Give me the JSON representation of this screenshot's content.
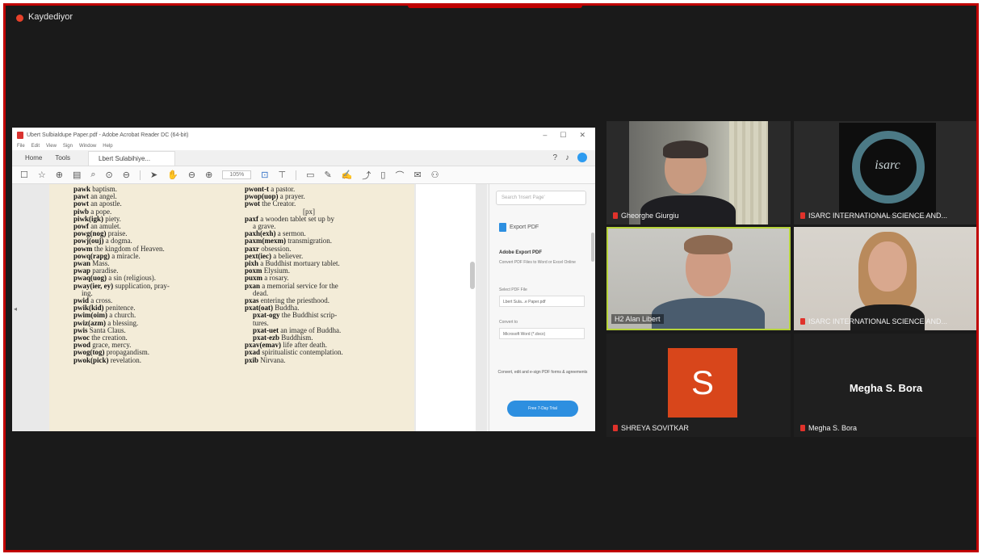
{
  "recording": {
    "label": "Kaydediyor"
  },
  "acrobat": {
    "window_title": "Ubert Sulbialdupe Paper.pdf - Adobe Acrobat Reader DC (64-bit)",
    "window_controls": [
      "–",
      "☐",
      "✕"
    ],
    "menu": [
      "File",
      "Edit",
      "View",
      "Sign",
      "Window",
      "Help"
    ],
    "tabs": {
      "home": "Home",
      "tools": "Tools",
      "doc": "Lbert Sulabihiye..."
    },
    "zoom": "105%",
    "search_placeholder": "Search 'Insert Page'",
    "export": {
      "header": "Export PDF",
      "title": "Adobe Export PDF",
      "description": "Convert PDF Files to Word or Excel Online",
      "select_label": "Select PDF File",
      "selected_file": "Lbert Sula...e Paper.pdf",
      "convert_label": "Convert to",
      "convert_value": "Microsoft Word (*.docx)",
      "promo": "Convert, edit and e-sign PDF forms & agreements",
      "cta": "Free 7-Day Trial"
    },
    "dictionary": {
      "left": [
        {
          "hw": "pawk",
          "def": "baptism."
        },
        {
          "hw": "pawt",
          "def": "an angel."
        },
        {
          "hw": "powt",
          "def": "an apostle."
        },
        {
          "hw": "piwb",
          "def": "a pope."
        },
        {
          "hw": "piwk(igk)",
          "def": "piety."
        },
        {
          "hw": "powf",
          "def": "an amulet."
        },
        {
          "hw": "powg(nog)",
          "def": "praise."
        },
        {
          "hw": "powj(ouj)",
          "def": "a dogma."
        },
        {
          "hw": "powm",
          "def": "the kingdom of Heaven."
        },
        {
          "hw": "powq(rapg)",
          "def": "a miracle."
        },
        {
          "hw": "pwan",
          "def": "Mass."
        },
        {
          "hw": "pwap",
          "def": "paradise."
        },
        {
          "hw": "pwaq(uog)",
          "def": "a sin (religious)."
        },
        {
          "hw": "pway(ier, ey)",
          "def": "supplication, pray-"
        },
        {
          "hw": "",
          "def": "ing.",
          "indent": true
        },
        {
          "hw": "pwid",
          "def": "a cross."
        },
        {
          "hw": "pwik(kid)",
          "def": "penitence."
        },
        {
          "hw": "pwim(oim)",
          "def": "a church."
        },
        {
          "hw": "pwiz(azm)",
          "def": "a blessing."
        },
        {
          "hw": "pwis",
          "def": "Santa Claus."
        },
        {
          "hw": "pwoc",
          "def": "the creation."
        },
        {
          "hw": "pwod",
          "def": "grace, mercy."
        },
        {
          "hw": "pwog(tog)",
          "def": "propagandism."
        },
        {
          "hw": "pwok(pick)",
          "def": "revelation."
        }
      ],
      "right": [
        {
          "hw": "pwont-t",
          "def": "a pastor."
        },
        {
          "hw": "pwop(uop)",
          "def": "a prayer."
        },
        {
          "hw": "pwot",
          "def": "the Creator."
        },
        {
          "hw": "",
          "def": "[px]",
          "center": true
        },
        {
          "hw": "paxf",
          "def": "a wooden tablet set up by"
        },
        {
          "hw": "",
          "def": "a grave.",
          "indent": true
        },
        {
          "hw": "paxh(exh)",
          "def": "a sermon."
        },
        {
          "hw": "paxm(mexm)",
          "def": "transmigration."
        },
        {
          "hw": "paxr",
          "def": "obsession."
        },
        {
          "hw": "pext(iec)",
          "def": "a believer."
        },
        {
          "hw": "pixh",
          "def": "a Buddhist mortuary tablet."
        },
        {
          "hw": "poxm",
          "def": "Elysium."
        },
        {
          "hw": "puxm",
          "def": "a rosary."
        },
        {
          "hw": "pxan",
          "def": "a memorial service for the"
        },
        {
          "hw": "",
          "def": "dead.",
          "indent": true
        },
        {
          "hw": "pxas",
          "def": "entering the priesthood."
        },
        {
          "hw": "pxat(oat)",
          "def": "Buddha."
        },
        {
          "hw": "pxat-ogy",
          "def": "the Buddhist scrip-",
          "indent": true
        },
        {
          "hw": "",
          "def": "tures.",
          "indent": true
        },
        {
          "hw": "pxat-uet",
          "def": "an image of Buddha.",
          "indent": true
        },
        {
          "hw": "pxat-ezb",
          "def": "Buddhism.",
          "indent": true
        },
        {
          "hw": "pxav(emav)",
          "def": "life after death."
        },
        {
          "hw": "pxad",
          "def": "spiritualistic contemplation."
        },
        {
          "hw": "pxib",
          "def": "Nirvana."
        }
      ]
    }
  },
  "participants": [
    {
      "name": "Gheorghe Giurgiu"
    },
    {
      "name": "ISARC INTERNATIONAL SCIENCE AND...",
      "logo_text": "isarc"
    },
    {
      "name": "H2 Alan Libert"
    },
    {
      "name": "ISARC INTERNATIONAL SCIENCE AND..."
    },
    {
      "name": "SHREYA SOVITKAR",
      "initial": "S"
    },
    {
      "name": "Megha S. Bora",
      "display": "Megha S. Bora"
    }
  ],
  "colors": {
    "accent": "#c00000",
    "active_speaker": "#b7d43a",
    "avatar": "#d8461b",
    "acrobat_blue": "#2d8fe0"
  }
}
